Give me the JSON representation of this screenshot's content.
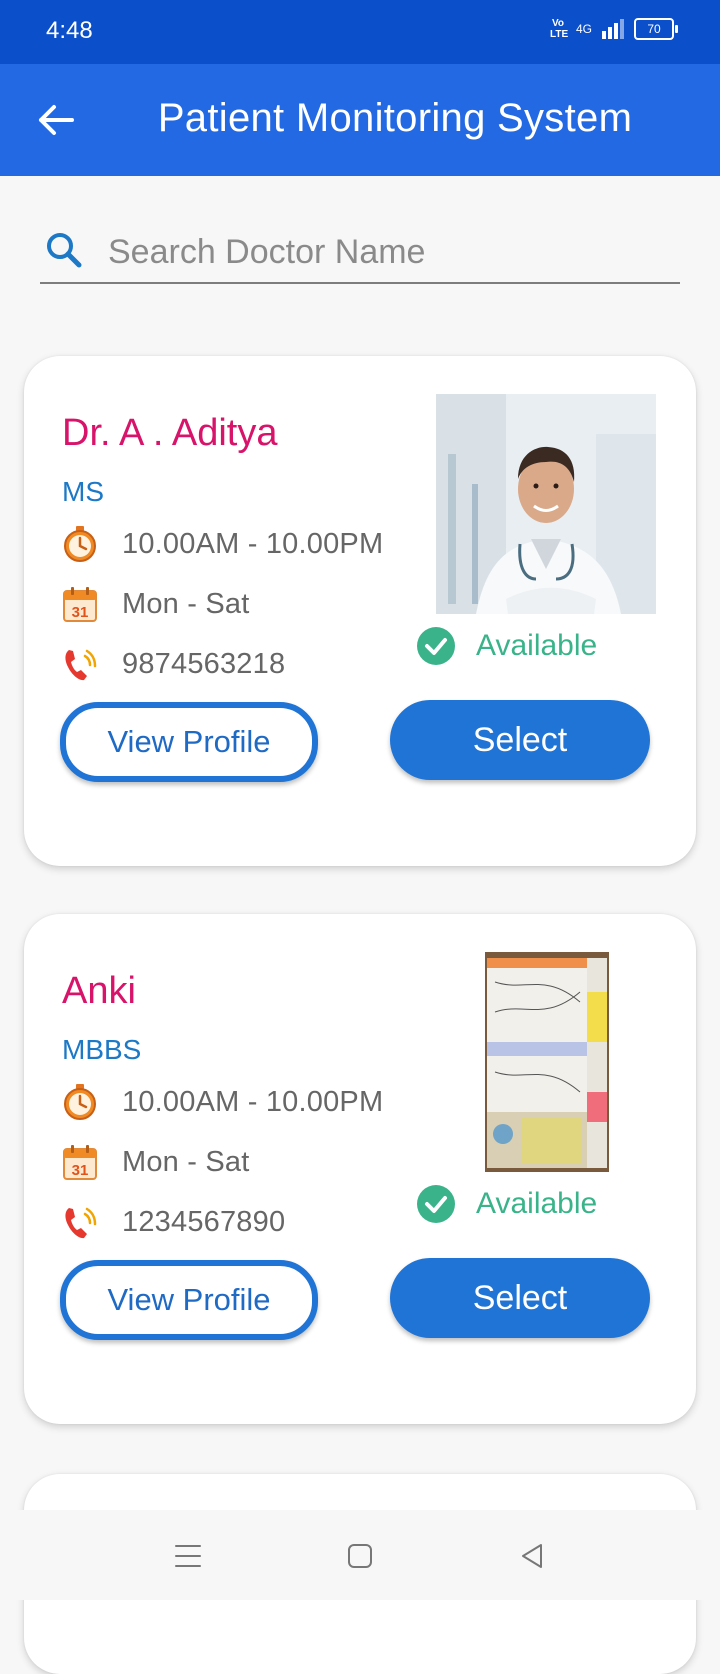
{
  "status_bar": {
    "time": "4:48",
    "volte": "Vo LTE",
    "network": "4G",
    "battery": "70"
  },
  "app_bar": {
    "title": "Patient Monitoring System",
    "back_icon": "arrow-left-icon"
  },
  "search": {
    "placeholder": "Search Doctor Name",
    "value": "",
    "icon": "search-icon"
  },
  "doctors": [
    {
      "name": "Dr. A . Aditya",
      "degree": "MS",
      "timing": "10.00AM - 10.00PM",
      "days": "Mon - Sat",
      "phone": "9874563218",
      "availability": "Available",
      "view_profile_label": "View Profile",
      "select_label": "Select"
    },
    {
      "name": "Anki",
      "degree": "MBBS",
      "timing": "10.00AM - 10.00PM",
      "days": "Mon - Sat",
      "phone": "1234567890",
      "availability": "Available",
      "view_profile_label": "View Profile",
      "select_label": "Select"
    }
  ],
  "colors": {
    "status_bar": "#0b4fca",
    "app_bar": "#2469e4",
    "doctor_name": "#d8136a",
    "degree": "#1d78c6",
    "available": "#3bb38a",
    "primary_button": "#1f74d6"
  },
  "icons": {
    "timing": "stopwatch-icon",
    "days": "calendar-icon",
    "phone": "phone-ringing-icon",
    "available": "check-circle-icon"
  },
  "nav_bar": {
    "menu_icon": "menu-icon",
    "home_icon": "square-home-icon",
    "back_icon": "triangle-back-icon"
  }
}
